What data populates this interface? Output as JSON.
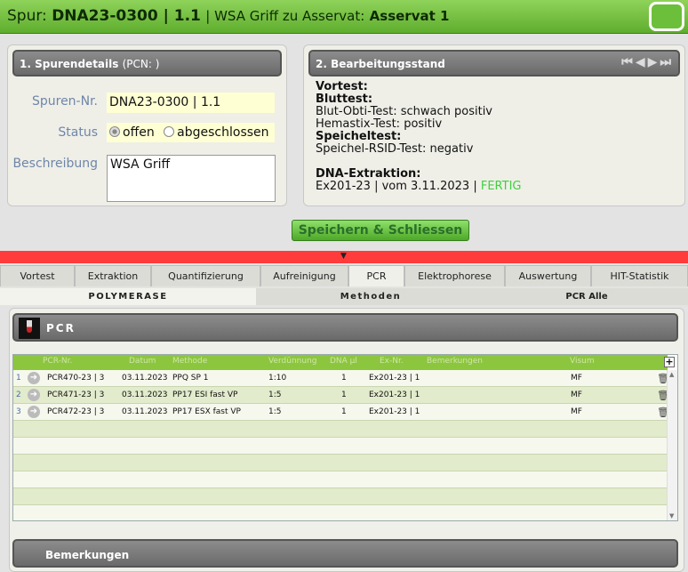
{
  "header": {
    "prefix": "Spur:",
    "spur_id": "DNA23-0300 | 1.1",
    "mid": "| WSA Griff zu Asservat:",
    "asservat": "Asservat 1"
  },
  "panel1": {
    "title": "1. Spurendetails",
    "pcn": "(PCN: )",
    "spuren_label": "Spuren-Nr.",
    "spuren_value": "DNA23-0300 | 1.1",
    "status_label": "Status",
    "status_options": [
      "offen",
      "abgeschlossen"
    ],
    "status_selected": "offen",
    "beschreibung_label": "Beschreibung",
    "beschreibung_value": "WSA Griff"
  },
  "panel2": {
    "title": "2. Bearbeitungsstand",
    "vortest": "Vortest:",
    "bluttest": "Bluttest:",
    "blut_obti": "Blut-Obti-Test: schwach positiv",
    "hemastix": "Hemastix-Test: positiv",
    "speicheltest": "Speicheltest:",
    "speichel_rsid": "Speichel-RSID-Test: negativ",
    "dna_extraktion": "DNA-Extraktion:",
    "extraction_info": "Ex201-23 | vom 3.11.2023 |",
    "extraction_status": "FERTIG"
  },
  "save_button": "Speichern & Schliessen",
  "tabs": [
    "Vortest",
    "Extraktion",
    "Quantifizierung",
    "Aufreinigung",
    "PCR",
    "Elektrophorese",
    "Auswertung",
    "HIT-Statistik"
  ],
  "active_tab": "PCR",
  "subtabs": [
    "POLYMERASE",
    "Methoden",
    "PCR Alle"
  ],
  "pcr_section_title": "PCR",
  "grid": {
    "columns": [
      "PCR-Nr.",
      "Datum",
      "Methode",
      "Verdünnung",
      "DNA µl",
      "Ex-Nr.",
      "Bemerkungen",
      "Visum"
    ],
    "rows": [
      {
        "n": "1",
        "pcr": "PCR470-23 | 3",
        "datum": "03.11.2023",
        "methode": "PPQ SP 1",
        "verd": "1:10",
        "dna": "1",
        "ex": "Ex201-23 | 1",
        "bem": "",
        "visum": "MF"
      },
      {
        "n": "2",
        "pcr": "PCR471-23 | 3",
        "datum": "03.11.2023",
        "methode": "PP17 ESI fast VP",
        "verd": "1:5",
        "dna": "1",
        "ex": "Ex201-23 | 1",
        "bem": "",
        "visum": "MF"
      },
      {
        "n": "3",
        "pcr": "PCR472-23 | 3",
        "datum": "03.11.2023",
        "methode": "PP17 ESX fast VP",
        "verd": "1:5",
        "dna": "1",
        "ex": "Ex201-23 | 1",
        "bem": "",
        "visum": "MF"
      }
    ]
  },
  "bemerkungen_title": "Bemerkungen"
}
